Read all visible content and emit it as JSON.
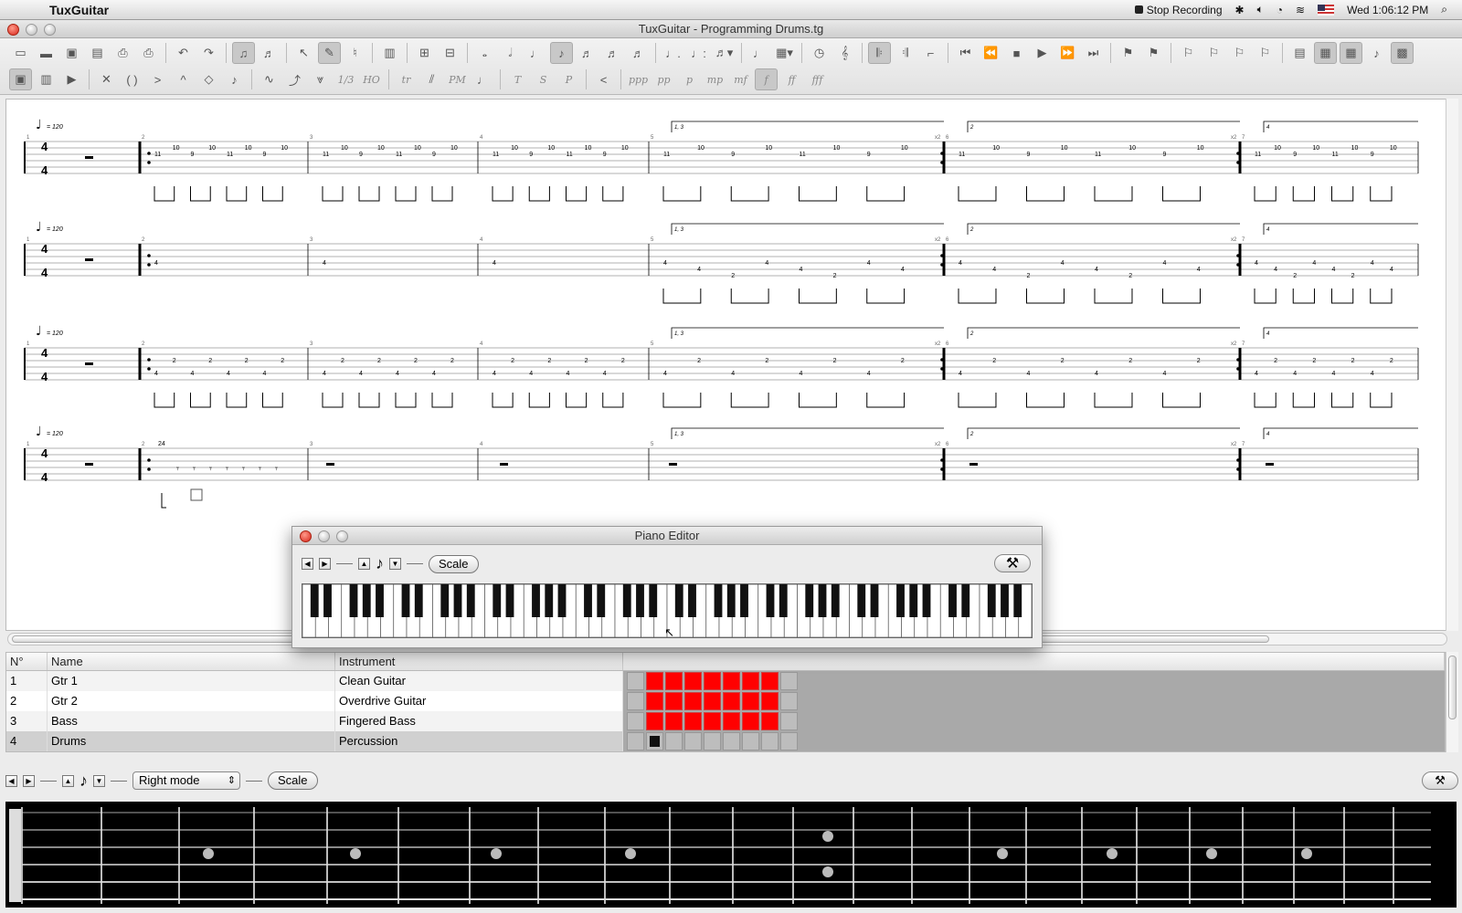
{
  "menubar": {
    "app_name": "TuxGuitar",
    "stop_recording": "Stop Recording",
    "clock": "Wed 1:06:12 PM"
  },
  "window": {
    "title": "TuxGuitar - Programming Drums.tg"
  },
  "toolbar": {
    "dynamics": [
      "ppp",
      "pp",
      "p",
      "mp",
      "mf",
      "f",
      "ff",
      "fff"
    ],
    "effect_labels": [
      "1/3",
      "HO",
      "tr",
      "PM",
      "T",
      "S",
      "P"
    ]
  },
  "score": {
    "tempo_label": "= 120",
    "time_signature": [
      "4",
      "4"
    ],
    "volta_labels": [
      "1, 3",
      "2",
      "4"
    ],
    "repeat_label": "x2",
    "bar_numbers": [
      "1",
      "2",
      "3",
      "4",
      "5",
      "6",
      "7"
    ]
  },
  "tracks": {
    "headers": [
      "N°",
      "Name",
      "Instrument"
    ],
    "rows": [
      {
        "num": "1",
        "name": "Gtr 1",
        "instrument": "Clean Guitar"
      },
      {
        "num": "2",
        "name": "Gtr 2",
        "instrument": "Overdrive Guitar"
      },
      {
        "num": "3",
        "name": "Bass",
        "instrument": "Fingered Bass"
      },
      {
        "num": "4",
        "name": "Drums",
        "instrument": "Percussion"
      }
    ]
  },
  "piano_editor": {
    "title": "Piano Editor",
    "scale_label": "Scale"
  },
  "fretboard": {
    "mode_select": "Right mode",
    "scale_label": "Scale"
  },
  "colors": {
    "track_cell_filled": "#ff0000",
    "selected_key": "#1f4a72"
  }
}
